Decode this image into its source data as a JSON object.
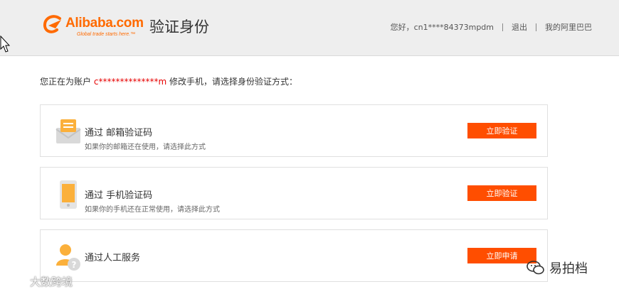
{
  "header": {
    "logo": {
      "brand": "Alibaba.com",
      "tagline": "Global trade starts here.™"
    },
    "title": "验证身份",
    "greeting": "您好，cn1****84373mpdm",
    "logout": "退出",
    "my_alibaba": "我的阿里巴巴"
  },
  "prompt": {
    "prefix": "您正在为账户",
    "account": "c**************m",
    "suffix": "修改手机，请选择身份验证方式："
  },
  "options": [
    {
      "title": "通过 邮箱验证码",
      "desc": "如果你的邮箱还在使用，请选择此方式",
      "button": "立即验证",
      "icon": "envelope-icon"
    },
    {
      "title": "通过 手机验证码",
      "desc": "如果你的手机还在正常使用，请选择此方式",
      "button": "立即验证",
      "icon": "phone-icon"
    },
    {
      "title": "通过人工服务",
      "desc": "",
      "button": "立即申请",
      "icon": "user-question-icon"
    }
  ],
  "watermarks": {
    "left": "大数跨境",
    "right": "易拍档"
  },
  "colors": {
    "accent": "#ff4e00",
    "brand": "#ff6a00",
    "account": "#e60000",
    "header_bg": "#eeeeee"
  }
}
